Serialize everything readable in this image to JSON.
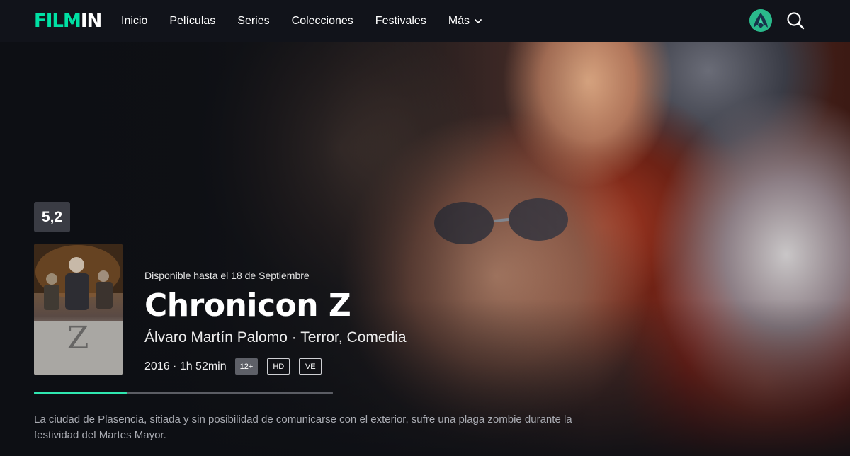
{
  "brand": {
    "logo_part1": "FILM",
    "logo_part2": "IN"
  },
  "nav": {
    "items": [
      {
        "label": "Inicio"
      },
      {
        "label": "Películas"
      },
      {
        "label": "Series"
      },
      {
        "label": "Colecciones"
      },
      {
        "label": "Festivales"
      },
      {
        "label": "Más"
      }
    ]
  },
  "icons": {
    "more": "chevron-down-icon",
    "search": "search-icon",
    "avatar": "user-avatar"
  },
  "movie": {
    "rating": "5,2",
    "availability": "Disponible hasta el 18 de Septiembre",
    "title": "Chronicon Z",
    "credits": "Álvaro Martín Palomo · Terror, Comedia",
    "year_duration": "2016 · 1h 52min",
    "badges": [
      "12+",
      "HD",
      "VE"
    ],
    "progress_percent": 31,
    "synopsis": "La ciudad de Plasencia, sitiada y sin posibilidad de comunicarse con el exterior, sufre una plaga zombie durante la festividad del Martes Mayor."
  },
  "colors": {
    "accent": "#00e0a4",
    "progress": "#2fe6b0",
    "background": "#0d0f14"
  }
}
